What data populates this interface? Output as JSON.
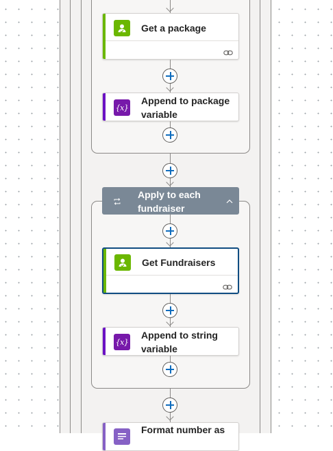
{
  "flow": {
    "steps": [
      {
        "title": "Get a package",
        "icon": "pbi-user-check-icon",
        "accent": "#6bb700",
        "icon_bg": "#6bb700"
      },
      {
        "title": "Append to package variable",
        "icon": "variable-icon",
        "accent": "#6b12c4",
        "icon_bg": "#7719aa"
      },
      {
        "title": "Get Fundraisers",
        "icon": "pbi-user-check-icon",
        "accent": "#6bb700",
        "icon_bg": "#6bb700"
      },
      {
        "title": "Append to string variable",
        "icon": "variable-icon",
        "accent": "#6b12c4",
        "icon_bg": "#7719aa"
      },
      {
        "title": "Format number as",
        "icon": "data-operation-icon",
        "accent": "#8661c5",
        "icon_bg": "#8661c5"
      }
    ],
    "foreach": {
      "title": "Apply to each fundraiser",
      "icon": "loop-icon",
      "color": "#7a8896"
    },
    "variable_glyph": "{x}"
  },
  "colors": {
    "add_plus": "#0f6cbd",
    "connector": "#8a8886",
    "selected_border": "#0f4c81"
  }
}
